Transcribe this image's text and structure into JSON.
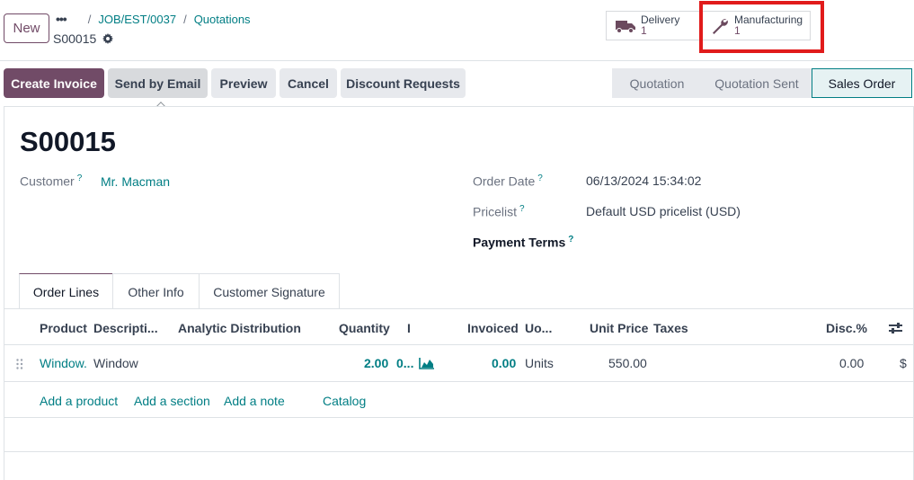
{
  "topbar": {
    "new_label": "New",
    "crumb_1": "JOB/EST/0037",
    "crumb_2": "Quotations",
    "record_name": "S00015"
  },
  "smart_buttons": {
    "delivery_label": "Delivery",
    "delivery_count": "1",
    "manufacturing_label": "Manufacturing",
    "manufacturing_count": "1"
  },
  "actions": {
    "create_invoice": "Create Invoice",
    "send_by_email": "Send by Email",
    "preview": "Preview",
    "cancel": "Cancel",
    "discount_requests": "Discount Requests"
  },
  "status_bar": {
    "stage_1": "Quotation",
    "stage_2": "Quotation Sent",
    "stage_3": "Sales Order",
    "current": "Sales Order"
  },
  "form": {
    "title": "S00015",
    "customer_label": "Customer",
    "customer_value": "Mr. Macman",
    "order_date_label": "Order Date",
    "order_date_value": "06/13/2024 15:34:02",
    "pricelist_label": "Pricelist",
    "pricelist_value": "Default USD pricelist (USD)",
    "payment_terms_label": "Payment Terms",
    "help_mark": "?"
  },
  "tabs": {
    "order_lines": "Order Lines",
    "other_info": "Other Info",
    "customer_signature": "Customer Signature"
  },
  "table": {
    "headers": {
      "product": "Product",
      "description": "Descripti...",
      "analytic": "Analytic Distribution",
      "quantity": "Quantity",
      "delivered": "I",
      "invoiced": "Invoiced",
      "uom": "Uo...",
      "unit_price": "Unit Price",
      "taxes": "Taxes",
      "disc": "Disc.%"
    },
    "row": {
      "product": "Window.",
      "description": "Window",
      "quantity": "2.00",
      "delivered": "0...",
      "invoiced": "0.00",
      "uom": "Units",
      "unit_price": "550.00",
      "disc": "0.00",
      "subtotal": "$"
    },
    "add_product": "Add a product",
    "add_section": "Add a section",
    "add_note": "Add a note",
    "catalog": "Catalog"
  },
  "colors": {
    "brand": "#714b67",
    "link": "#017e84",
    "highlight": "#e11b1b"
  }
}
